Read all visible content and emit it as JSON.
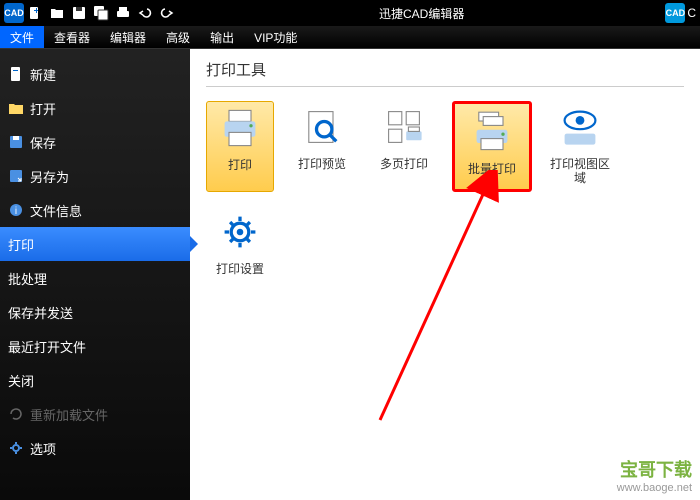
{
  "title": "迅捷CAD编辑器",
  "logo_text": "CAD",
  "menubar": {
    "items": [
      "文件",
      "查看器",
      "编辑器",
      "高级",
      "输出",
      "VIP功能"
    ],
    "active_index": 0
  },
  "sidebar": {
    "items": [
      {
        "label": "新建",
        "icon": "new"
      },
      {
        "label": "打开",
        "icon": "open"
      },
      {
        "label": "保存",
        "icon": "save"
      },
      {
        "label": "另存为",
        "icon": "saveas"
      },
      {
        "label": "文件信息",
        "icon": "info"
      },
      {
        "label": "打印",
        "icon": "print",
        "active": true
      },
      {
        "label": "批处理",
        "icon": "batch"
      },
      {
        "label": "保存并发送",
        "icon": "send"
      },
      {
        "label": "最近打开文件",
        "icon": "recent"
      },
      {
        "label": "关闭",
        "icon": "close"
      },
      {
        "label": "重新加载文件",
        "icon": "reload",
        "disabled": true
      },
      {
        "label": "选项",
        "icon": "options"
      }
    ]
  },
  "content": {
    "title": "打印工具",
    "tools": [
      {
        "label": "打印",
        "icon": "printer",
        "highlight": true
      },
      {
        "label": "打印预览",
        "icon": "preview"
      },
      {
        "label": "多页打印",
        "icon": "multipage"
      },
      {
        "label": "批量打印",
        "icon": "batchprint",
        "highlight": true,
        "redbox": true
      },
      {
        "label": "打印视图区域",
        "icon": "printview"
      },
      {
        "label": "打印设置",
        "icon": "printsettings"
      }
    ]
  },
  "watermark": {
    "brand": "宝哥下载",
    "url": "www.baoge.net"
  }
}
